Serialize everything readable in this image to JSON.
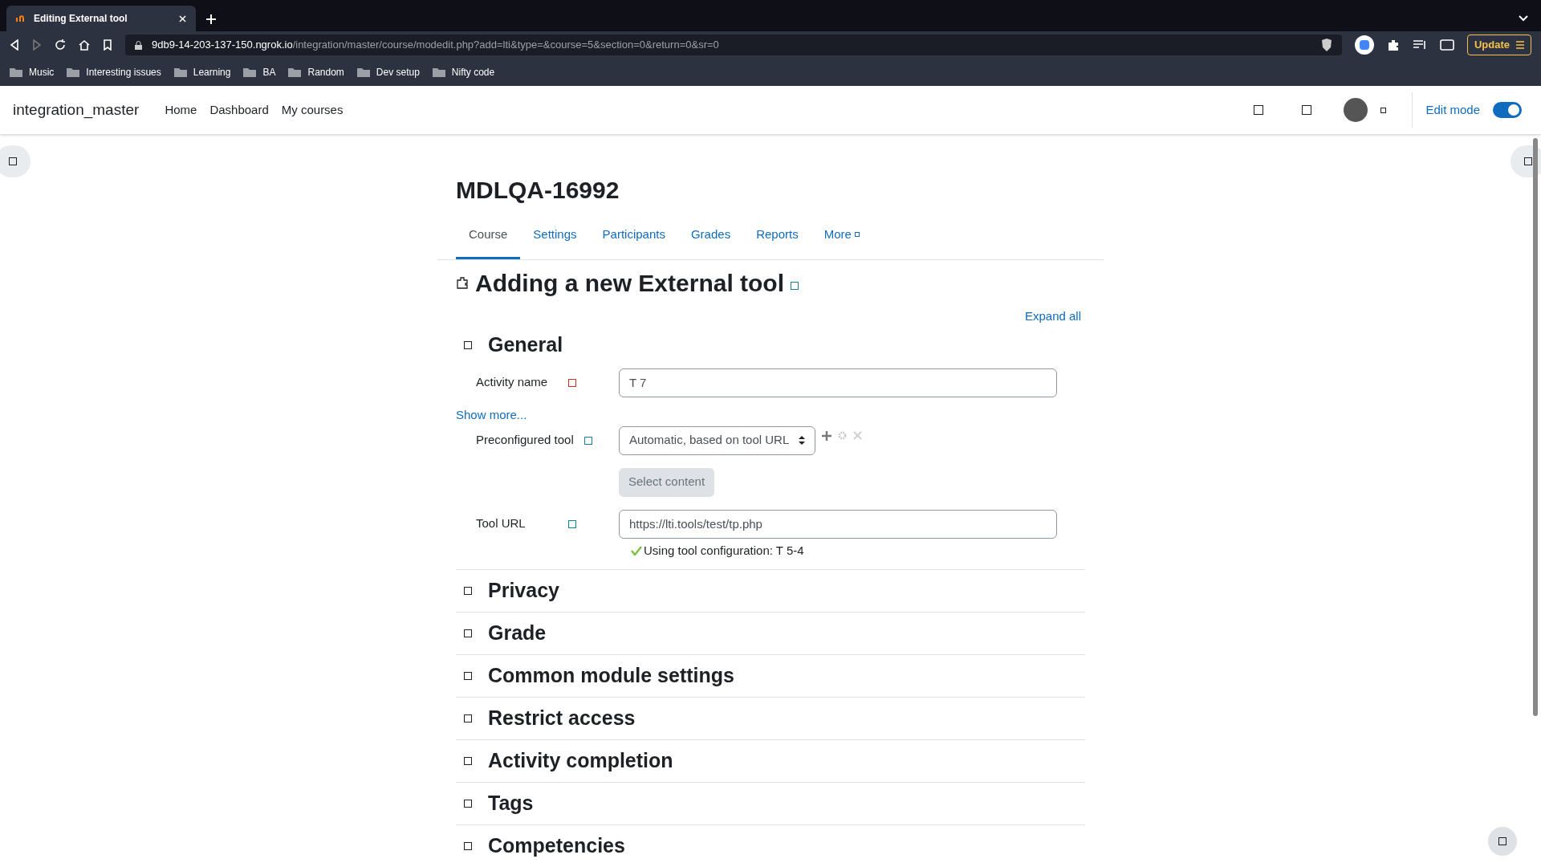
{
  "browser": {
    "tabs": [
      {
        "title": "Editing External tool",
        "selected": true
      }
    ],
    "url_host": "9db9-14-203-137-150.ngrok.io",
    "url_path": "/integration/master/course/modedit.php?add=lti&type=&course=5&section=0&return=0&sr=0",
    "update_button": "Update",
    "bookmarks": [
      "Music",
      "Interesting issues",
      "Learning",
      "BA",
      "Random",
      "Dev setup",
      "Nifty code"
    ]
  },
  "navbar": {
    "site_name": "integration_master",
    "links": [
      "Home",
      "Dashboard",
      "My courses"
    ],
    "edit_mode_label": "Edit mode",
    "edit_mode_on": true
  },
  "course": {
    "title": "MDLQA-16992",
    "tabs": [
      {
        "label": "Course",
        "selected": true
      },
      {
        "label": "Settings",
        "selected": false
      },
      {
        "label": "Participants",
        "selected": false
      },
      {
        "label": "Grades",
        "selected": false
      },
      {
        "label": "Reports",
        "selected": false
      },
      {
        "label": "More",
        "selected": false
      }
    ]
  },
  "page_heading": "Adding a new External tool",
  "expand_all": "Expand all",
  "general": {
    "title": "General",
    "activity_name_label": "Activity name",
    "activity_name_value": "T 7",
    "show_more": "Show more...",
    "preconfigured_label": "Preconfigured tool",
    "preconfigured_value": "Automatic, based on tool URL",
    "select_content": "Select content",
    "tool_url_label": "Tool URL",
    "tool_url_value": "https://lti.tools/test/tp.php",
    "config_note": "Using tool configuration: T 5-4"
  },
  "sections": [
    "Privacy",
    "Grade",
    "Common module settings",
    "Restrict access",
    "Activity completion",
    "Tags",
    "Competencies"
  ]
}
